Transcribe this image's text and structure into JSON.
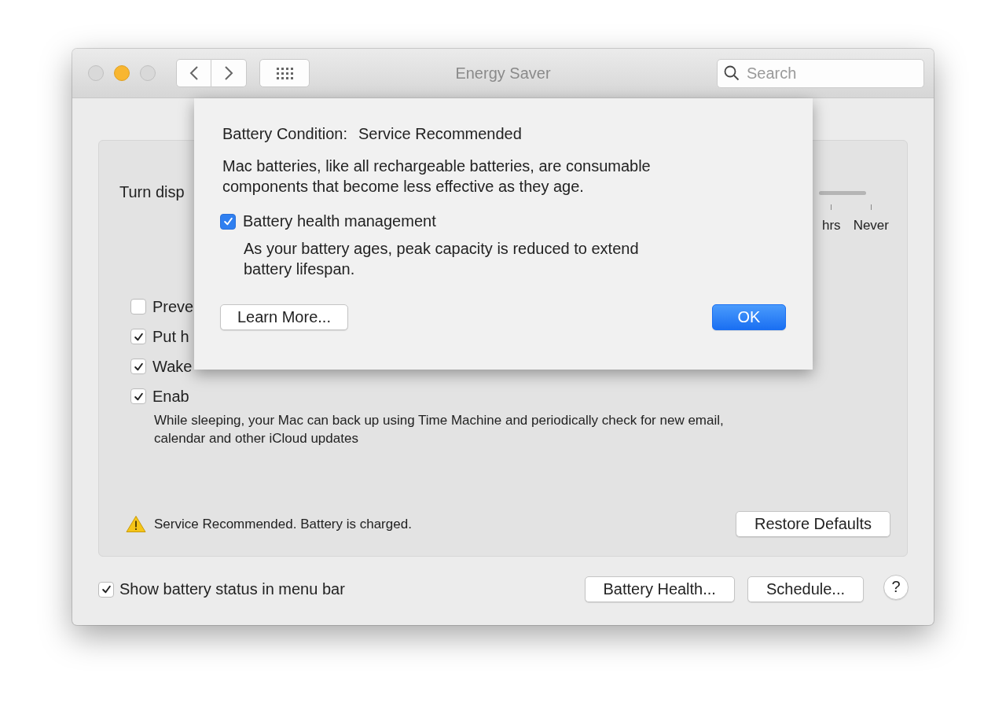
{
  "window": {
    "title": "Energy Saver",
    "controls": [
      {
        "kind": "close"
      },
      {
        "kind": "minimize"
      },
      {
        "kind": "zoom"
      }
    ]
  },
  "toolbar": {
    "search": {
      "placeholder": "Search"
    }
  },
  "panel": {
    "display_label": "Turn disp",
    "slider_labels": [
      "hrs",
      "Never"
    ],
    "options": [
      {
        "label": "Preve",
        "checked": false
      },
      {
        "label": "Put h",
        "checked": true
      },
      {
        "label": "Wake",
        "checked": true
      },
      {
        "label": "Enab",
        "checked": true
      }
    ],
    "option_note": [
      "While sleeping, your Mac can back up using Time Machine and periodically check for new email,",
      "calendar and other iCloud updates"
    ],
    "status": "Service Recommended. Battery is charged.",
    "restore_button": "Restore Defaults"
  },
  "footer": {
    "show_status": {
      "label": "Show battery status in menu bar",
      "checked": true
    },
    "buttons": [
      "Battery Health...",
      "Schedule..."
    ],
    "help": "?"
  },
  "sheet": {
    "condition_label": "Battery Condition:",
    "condition_value": "Service Recommended",
    "message": "Mac batteries, like all rechargeable batteries, are consumable components that become less effective as they age.",
    "option": {
      "label": "Battery health management",
      "checked": true
    },
    "note": "As your battery ages, peak capacity is reduced to extend battery lifespan.",
    "buttons": [
      {
        "label": "Learn More...",
        "kind": "normal"
      },
      {
        "label": "OK",
        "kind": "default"
      }
    ]
  }
}
